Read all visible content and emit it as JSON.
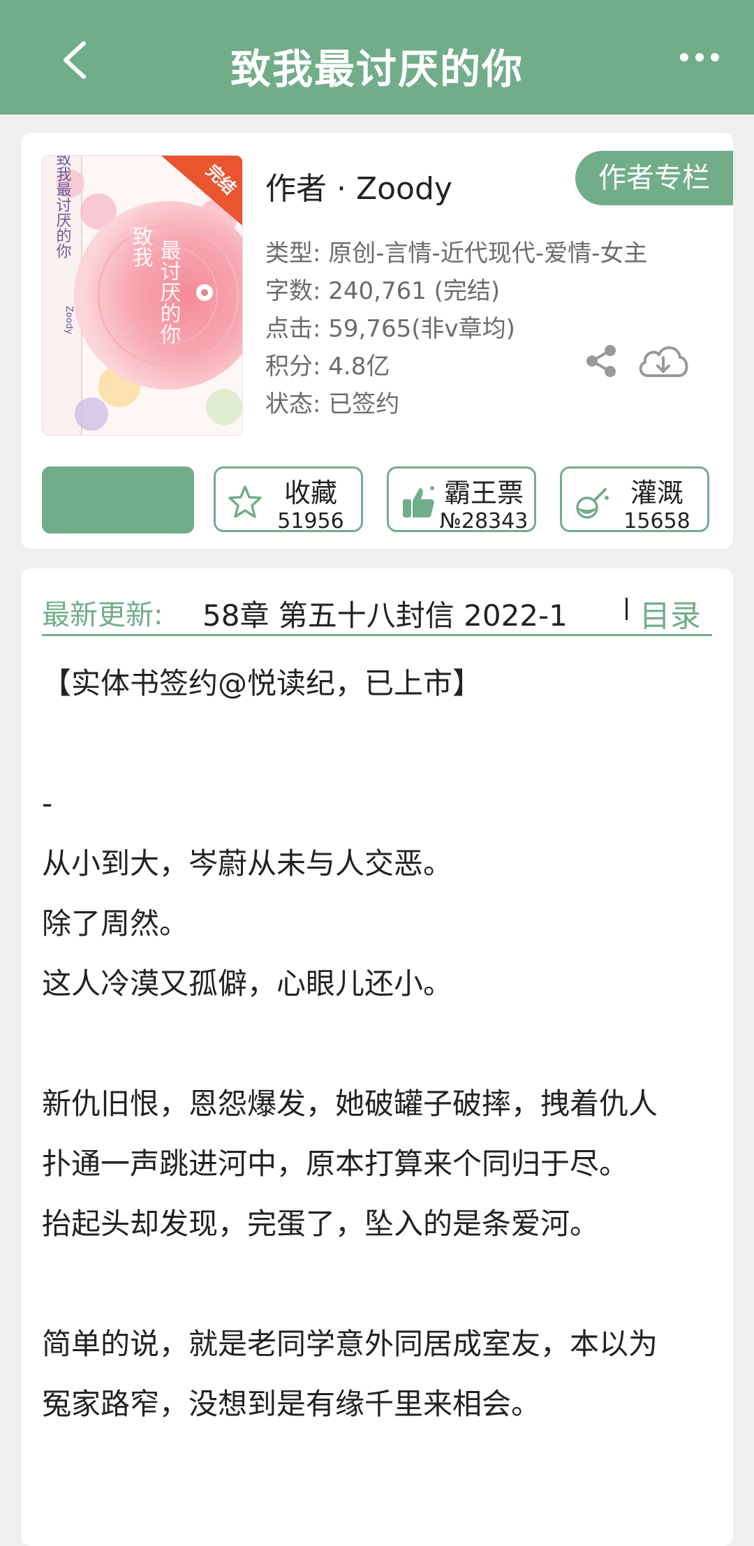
{
  "header": {
    "title": "致我最讨厌的你",
    "back_icon": "chevron-left-icon",
    "more_icon": "more-dots-icon"
  },
  "book": {
    "cover_badge": "完结",
    "cover_title": "致我最讨厌的你",
    "cover_author": "Zoody",
    "author_line": "作者 · Zoody",
    "author_column_button": "作者专栏",
    "meta": {
      "type": "类型: 原创-言情-近代现代-爱情-女主",
      "words": "字数: 240,761 (完结)",
      "clicks": "点击: 59,765(非v章均)",
      "score": "积分: 4.8亿",
      "status": "状态: 已签约"
    },
    "share_icon": "share-icon",
    "download_icon": "cloud-download-icon"
  },
  "actions": [
    {
      "label": "收藏",
      "count": "51956",
      "icon": "star-icon"
    },
    {
      "label": "霸王票",
      "count": "№28343",
      "icon": "thumbs-up-icon"
    },
    {
      "label": "灌溉",
      "count": "15658",
      "icon": "nutrient-flask-icon"
    }
  ],
  "latest": {
    "label": "最新更新:",
    "text": "58章 第五十八封信 2022-1",
    "toc": "目录"
  },
  "intro": [
    "【实体书签约@悦读纪，已上市】",
    "",
    "-",
    "从小到大，岑蔚从未与人交恶。",
    "除了周然。",
    "这人冷漠又孤僻，心眼儿还小。",
    "",
    "新仇旧恨，恩怨爆发，她破罐子破摔，拽着仇人",
    "扑通一声跳进河中，原本打算来个同归于尽。",
    "抬起头却发现，完蛋了，坠入的是条爱河。",
    "",
    "简单的说，就是老同学意外同居成室友，本以为",
    "冤家路窄，没想到是有缘千里来相会。"
  ],
  "colors": {
    "accent": "#72ad8a",
    "background": "#efefef",
    "text": "#222222",
    "meta_text": "#6b6b6b"
  }
}
